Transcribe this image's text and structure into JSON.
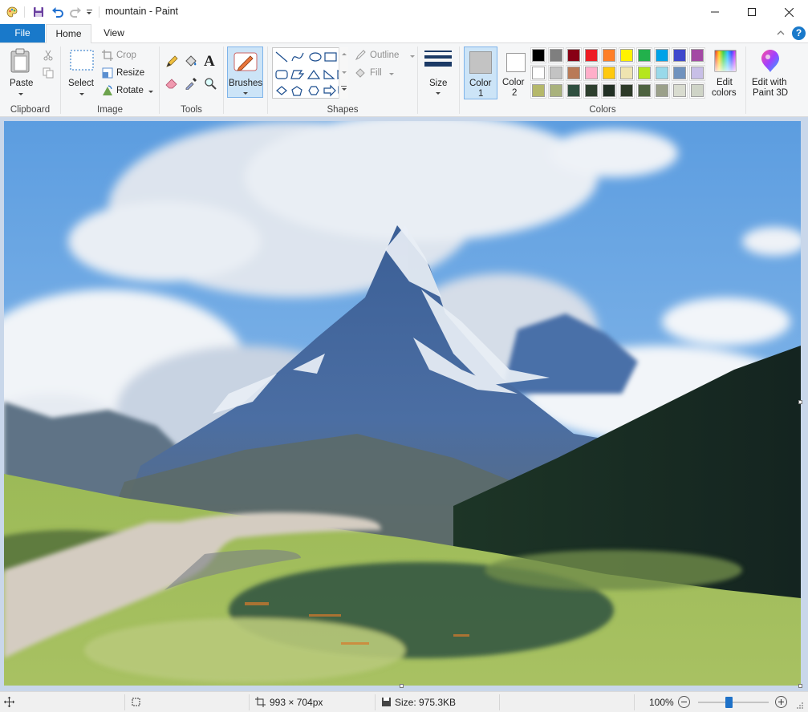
{
  "window": {
    "title": "mountain - Paint",
    "minimize_icon": "minimize-icon",
    "maximize_icon": "maximize-icon",
    "close_icon": "close-icon"
  },
  "tabs": {
    "file": "File",
    "home": "Home",
    "view": "View"
  },
  "ribbon": {
    "clipboard": {
      "paste": "Paste",
      "group": "Clipboard"
    },
    "image": {
      "select": "Select",
      "crop": "Crop",
      "resize": "Resize",
      "rotate": "Rotate",
      "group": "Image"
    },
    "tools": {
      "group": "Tools",
      "text_glyph": "A"
    },
    "brushes": "Brushes",
    "shapes": {
      "outline": "Outline",
      "fill": "Fill",
      "group": "Shapes"
    },
    "size": "Size",
    "colors": {
      "color1": "Color",
      "color1_num": "1",
      "color2": "Color",
      "color2_num": "2",
      "color1_value": "#c3c3c3",
      "color2_value": "#ffffff",
      "edit_colors": "Edit",
      "edit_colors_2": "colors",
      "paint3d": "Edit with",
      "paint3d_2": "Paint 3D",
      "group": "Colors",
      "palette_row1": [
        "#000000",
        "#7f7f7f",
        "#880015",
        "#ed1c24",
        "#ff7f27",
        "#fff200",
        "#22b14c",
        "#00a2e8",
        "#3f48cc",
        "#a349a4"
      ],
      "palette_row2": [
        "#ffffff",
        "#c3c3c3",
        "#b97a57",
        "#ffaec9",
        "#ffc90e",
        "#efe4b0",
        "#b5e61d",
        "#99d9ea",
        "#7092be",
        "#c8bfe7"
      ],
      "palette_row3": [
        "#b5b86a",
        "#a9b27c",
        "#2f4f3f",
        "#2d3f2d",
        "#223024",
        "#2d3a28",
        "#4e6340",
        "#9ba08a",
        "#d9dcd0",
        "#cfd4c7"
      ]
    }
  },
  "status": {
    "dimensions": "993 × 704px",
    "size": "Size: 975.3KB",
    "zoom": "100%",
    "zoom_percent": 100
  }
}
